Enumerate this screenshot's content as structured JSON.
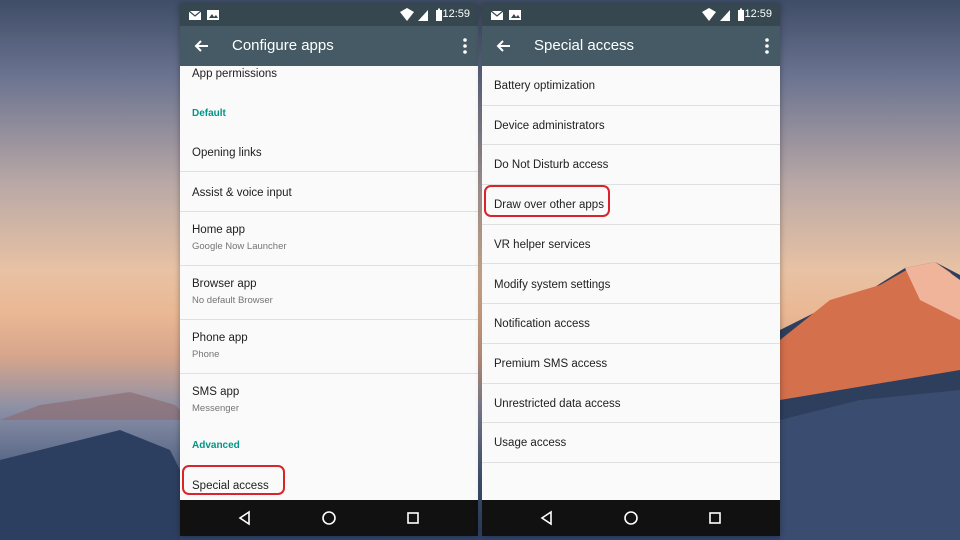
{
  "status": {
    "time": "12:59",
    "icons": [
      "mail-icon",
      "image-icon",
      "wifi-icon",
      "signal-icon",
      "battery-icon"
    ]
  },
  "left": {
    "title": "Configure apps",
    "top_item": "App permissions",
    "section_default": "Default",
    "items": [
      {
        "title": "Opening links"
      },
      {
        "title": "Assist & voice input"
      },
      {
        "title": "Home app",
        "subtitle": "Google Now Launcher"
      },
      {
        "title": "Browser app",
        "subtitle": "No default Browser"
      },
      {
        "title": "Phone app",
        "subtitle": "Phone"
      },
      {
        "title": "SMS app",
        "subtitle": "Messenger"
      }
    ],
    "section_advanced": "Advanced",
    "highlighted_item": "Special access"
  },
  "right": {
    "title": "Special access",
    "items": [
      "Battery optimization",
      "Device administrators",
      "Do Not Disturb access",
      "Draw over other apps",
      "VR helper services",
      "Modify system settings",
      "Notification access",
      "Premium SMS access",
      "Unrestricted data access",
      "Usage access"
    ]
  },
  "colors": {
    "accent": "#009688",
    "highlight": "#d8242b",
    "appbar": "#455a64",
    "statusbar": "#37474f"
  }
}
